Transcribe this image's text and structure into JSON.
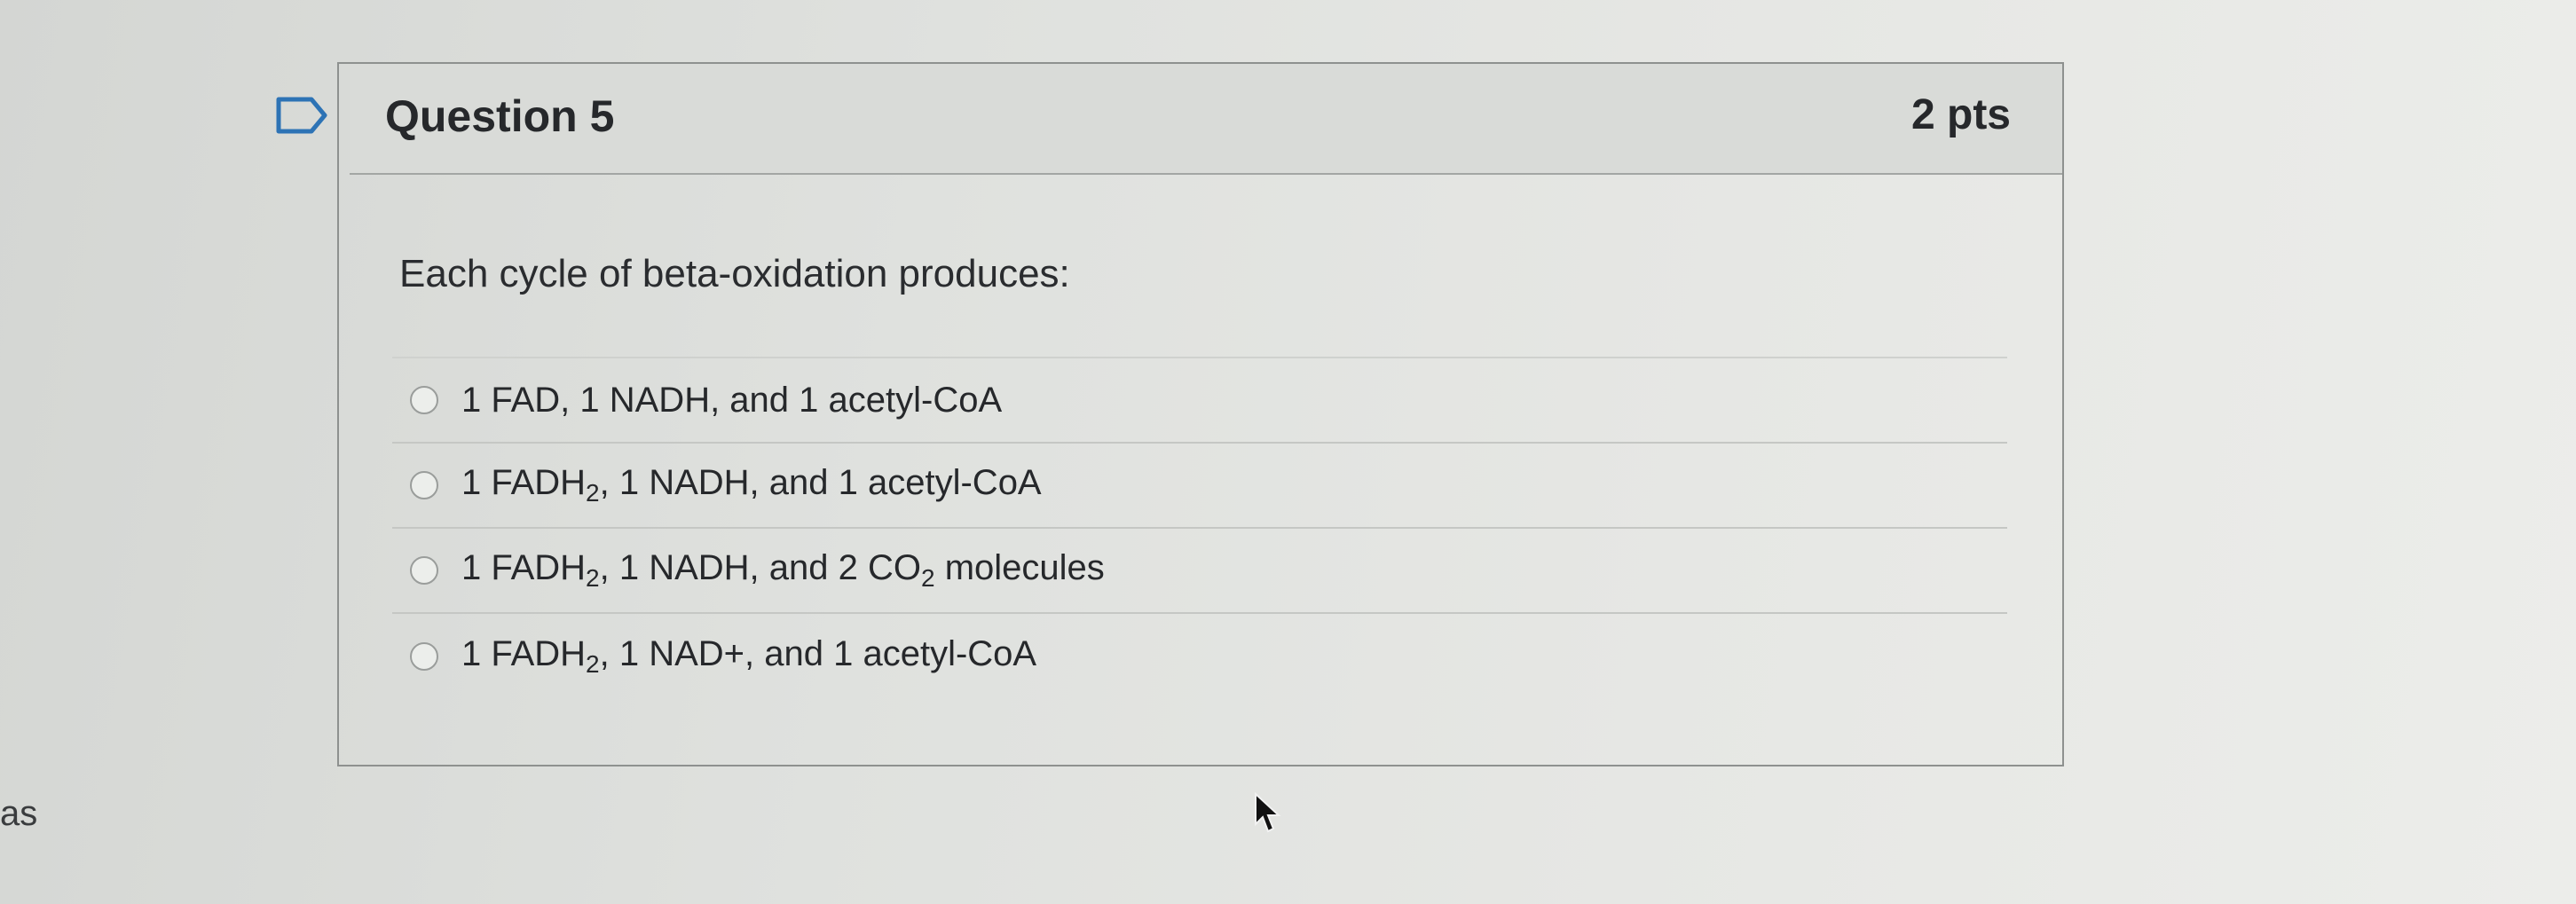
{
  "question": {
    "title": "Question 5",
    "points": "2 pts",
    "prompt": "Each cycle of beta-oxidation produces:",
    "flag_icon": "flag-outline-icon",
    "answers": [
      {
        "parts": [
          "1 FAD, 1 NADH, and 1 acetyl-CoA"
        ],
        "selected": false
      },
      {
        "parts": [
          "1 FADH",
          {
            "sub": "2"
          },
          ", 1 NADH, and 1 acetyl-CoA"
        ],
        "selected": false
      },
      {
        "parts": [
          "1 FADH",
          {
            "sub": "2"
          },
          ", 1 NADH, and 2 CO",
          {
            "sub": "2"
          },
          " molecules"
        ],
        "selected": false
      },
      {
        "parts": [
          "1 FADH",
          {
            "sub": "2"
          },
          ", 1 NAD+, and 1 acetyl-CoA"
        ],
        "selected": false
      }
    ]
  },
  "background_text": "as",
  "cursor_icon": "mouse-pointer-icon",
  "colors": {
    "background": "#dfe1de",
    "header_bg": "#d9dbd8",
    "border": "#8e918f",
    "text": "#26282b"
  }
}
